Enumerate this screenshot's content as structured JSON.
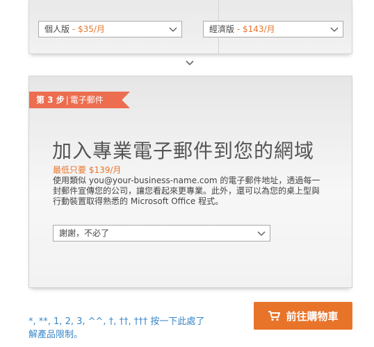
{
  "plans": [
    {
      "name": "個人版",
      "sep": " - ",
      "price": "$35/月"
    },
    {
      "name": "經濟版",
      "sep": " - ",
      "price": "$143/月"
    }
  ],
  "step3": {
    "step_label": "第 3 步",
    "step_bar": "|",
    "step_title": "電子郵件",
    "headline": "加入專業電子郵件到您的網域",
    "price_line": "最低只要 $139/月",
    "description": "使用類似 you@your-business-name.com 的電子郵件地址，透過每一封郵件宣傳您的公司，讓您看起來更專業。此外，還可以為您的桌上型與行動裝置取得熟悉的 Microsoft Office 程式。",
    "select_value": "謝謝，不必了"
  },
  "footer": {
    "footnote": "*, **, 1, 2, 3, ^^, †, ††, ††† 按一下此處了解產品限制。",
    "cart_button": "前往購物車"
  },
  "colors": {
    "accent": "#e8742a",
    "ribbon": "#ec6d4f",
    "link": "#3a87c8"
  },
  "icons": [
    "chevron-down-icon",
    "cart-icon"
  ]
}
